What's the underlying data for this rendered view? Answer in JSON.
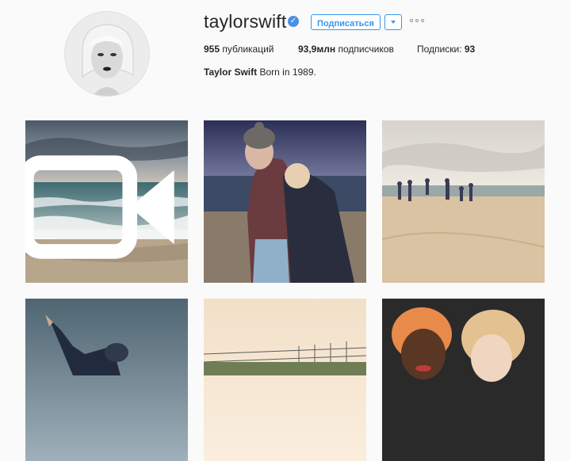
{
  "profile": {
    "username": "taylorswift",
    "verified_mark": "✓",
    "follow_label": "Подписаться",
    "stats": {
      "posts_count": "955",
      "posts_label": "публикаций",
      "followers_count": "93,9млн",
      "followers_label": "подписчиков",
      "following_label": "Подписки:",
      "following_count": "93"
    },
    "bio": {
      "name": "Taylor Swift",
      "text": "Born in 1989."
    }
  },
  "posts": [
    {
      "label": "beach-waves-video",
      "is_video": true
    },
    {
      "label": "two-people-hugging-beach"
    },
    {
      "label": "people-running-on-beach"
    },
    {
      "label": "person-raising-arm"
    },
    {
      "label": "fence-and-flagpole"
    },
    {
      "label": "two-people-selfie"
    }
  ],
  "colors": {
    "accent": "#3897f0",
    "verified": "#4a90e2",
    "background": "#fafafa"
  },
  "icons": {
    "verified": "verified-badge-icon",
    "dropdown": "chevron-down-icon",
    "more": "more-options-icon",
    "video": "video-camera-icon"
  }
}
